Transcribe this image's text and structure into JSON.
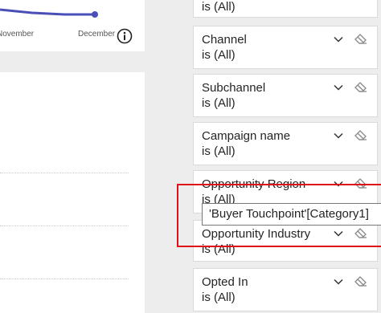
{
  "chart": {
    "x_labels": [
      "November",
      "December"
    ],
    "line_color": "#4a4fb8"
  },
  "filters": [
    {
      "title": "",
      "value": "is (All)"
    },
    {
      "title": "Channel",
      "value": "is (All)"
    },
    {
      "title": "Subchannel",
      "value": "is (All)"
    },
    {
      "title": "Campaign name",
      "value": "is (All)"
    },
    {
      "title": "Opportunity Region",
      "value": "is (All)"
    },
    {
      "title": "Opportunity Industry",
      "value": "is (All)"
    },
    {
      "title": "Opted In",
      "value": "is (All)"
    }
  ],
  "tooltip": {
    "text": "'Buyer Touchpoint'[Category1]"
  },
  "colors": {
    "highlight": "#e0101a",
    "pane_bg": "#ededed"
  }
}
